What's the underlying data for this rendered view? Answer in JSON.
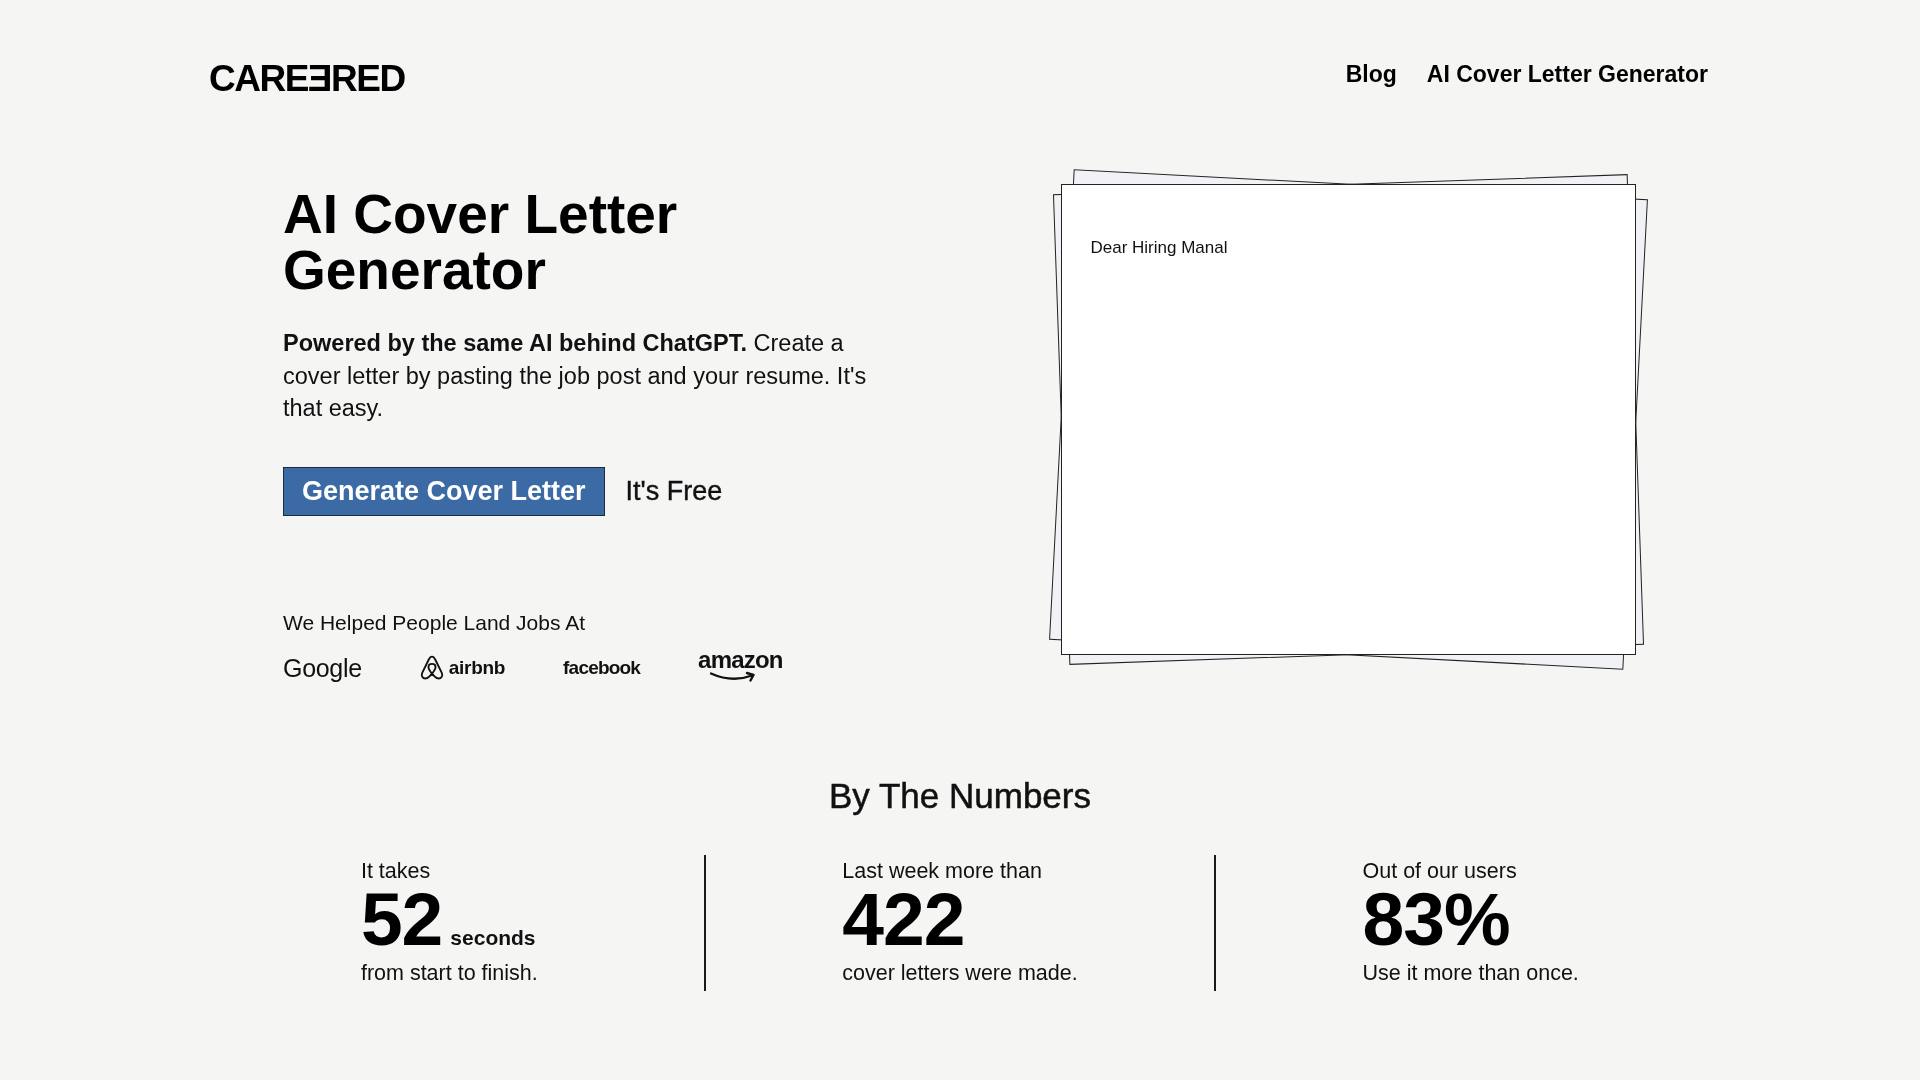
{
  "header": {
    "logo": "CAREƎRED",
    "nav": [
      {
        "label": "Blog"
      },
      {
        "label": "AI Cover Letter Generator"
      }
    ]
  },
  "hero": {
    "title": "AI Cover Letter Generator",
    "description": "**Powered by the same AI behind ChatGPT.** Create a cover letter by pasting the job post and your resume. It's that easy.",
    "cta_button": "Generate Cover Letter",
    "cta_note": "It's Free",
    "companies_heading": "We Helped People Land Jobs At",
    "companies": [
      {
        "name": "Google",
        "kind": "plain"
      },
      {
        "name": "airbnb",
        "kind": "symbol"
      },
      {
        "name": "facebook",
        "kind": "heavy"
      },
      {
        "name": "amazon",
        "kind": "smile"
      }
    ]
  },
  "letter_preview": {
    "text": "Dear Hiring Manal"
  },
  "stats": {
    "title": "By The Numbers",
    "items": [
      {
        "lead": "It takes",
        "value": "52",
        "unit": "seconds",
        "caption": "from start to finish."
      },
      {
        "lead": "Last week more than",
        "value": "422",
        "caption": "cover letters were made."
      },
      {
        "lead": "Out of our users",
        "value": "83%",
        "caption": "Use it more than once."
      }
    ]
  }
}
